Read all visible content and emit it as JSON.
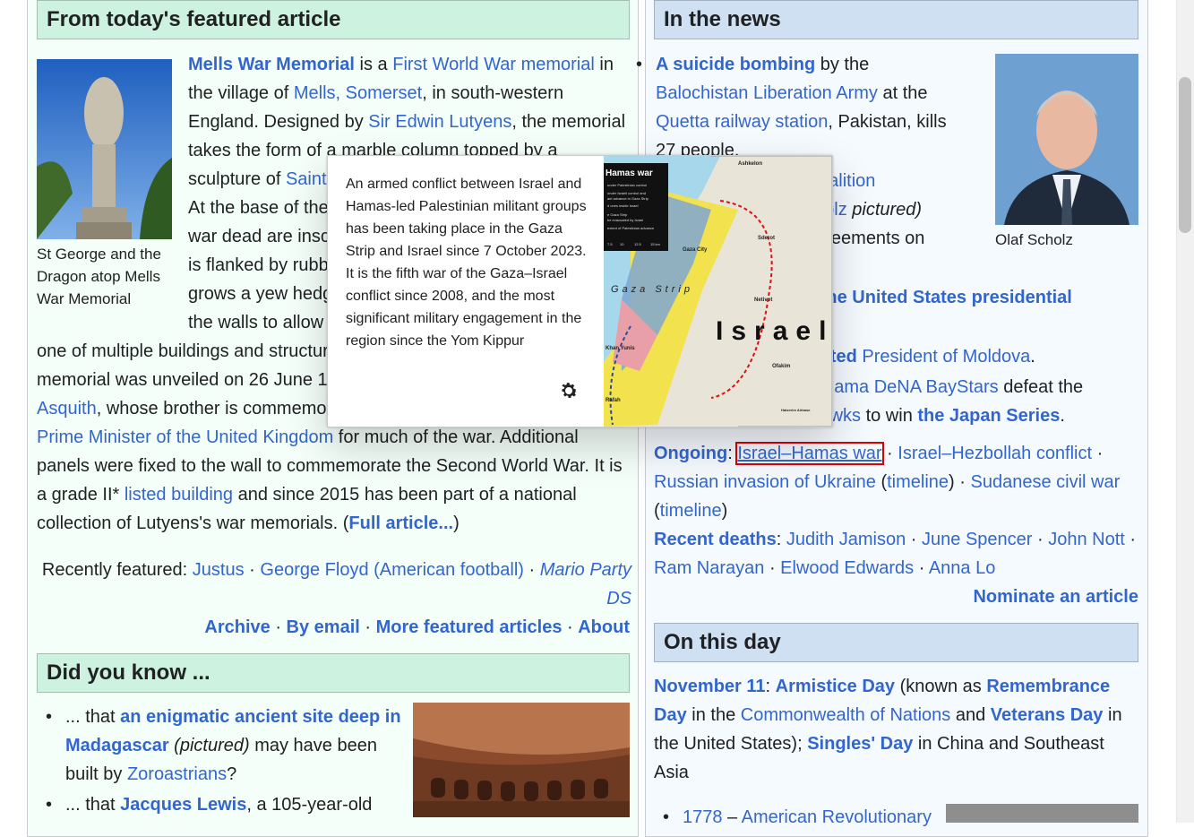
{
  "featured": {
    "heading": "From today's featured article",
    "image_caption": "St George and the Dragon atop Mells War Memorial",
    "lines": [
      [
        {
          "t": "Mells War Memorial",
          "k": "b"
        },
        {
          "t": " is a ",
          "k": "p"
        },
        {
          "t": "First World War memorial",
          "k": "a"
        },
        {
          "t": " in",
          "k": "p"
        }
      ],
      [
        {
          "t": "the village of ",
          "k": "p"
        },
        {
          "t": "Mells, Somerset",
          "k": "a"
        },
        {
          "t": ", in south-western",
          "k": "p"
        }
      ],
      [
        {
          "t": "England. Designed by ",
          "k": "p"
        },
        {
          "t": "Sir Edwin Lutyens",
          "k": "a"
        },
        {
          "t": ", the memorial",
          "k": "p"
        }
      ],
      [
        {
          "t": "takes the form of a marble column topped by a",
          "k": "p"
        }
      ],
      [
        {
          "t": "sculpture of ",
          "k": "p"
        },
        {
          "t": "Saint",
          "k": "a"
        }
      ],
      [
        {
          "t": "At the base of the",
          "k": "p"
        }
      ],
      [
        {
          "t": "war dead are insc",
          "k": "p"
        }
      ],
      [
        {
          "t": "is flanked by rubb",
          "k": "p"
        }
      ],
      [
        {
          "t": "grows a yew hedg",
          "k": "p"
        }
      ],
      [
        {
          "t": "the walls to allow",
          "k": "p"
        }
      ]
    ],
    "wide_lines": [
      [
        {
          "t": "one of multiple buildings and structur",
          "k": "p"
        }
      ],
      [
        {
          "t": "memorial was unveiled on 26 June 1",
          "k": "p"
        }
      ],
      [
        {
          "t": "Asquith",
          "k": "a"
        },
        {
          "t": ", whose brother is commemo",
          "k": "p"
        }
      ],
      [
        {
          "t": "Prime Minister of the United Kingdom",
          "k": "a"
        },
        {
          "t": " for much of the war. Additional",
          "k": "p"
        }
      ],
      [
        {
          "t": "panels were fixed to the wall to commemorate the Second World War. It is",
          "k": "p"
        }
      ],
      [
        {
          "t": "a grade II* ",
          "k": "p"
        },
        {
          "t": "listed building",
          "k": "a"
        },
        {
          "t": " and since 2015 has been part of a national",
          "k": "p"
        }
      ],
      [
        {
          "t": "collection of Lutyens's war memorials. (",
          "k": "p"
        },
        {
          "t": "Full article...",
          "k": "b"
        },
        {
          "t": ")",
          "k": "p"
        }
      ]
    ],
    "recently_label": "Recently featured: ",
    "recently_items": [
      "Justus",
      "George Floyd (American football)",
      "Mario Party DS"
    ],
    "footer_links": [
      "Archive",
      "By email",
      "More featured articles",
      "About"
    ]
  },
  "dyk": {
    "heading": "Did you know ...",
    "items": [
      [
        {
          "t": "... that ",
          "k": "p"
        },
        {
          "t": "an enigmatic ancient site deep in",
          "k": "b"
        }
      ],
      [
        {
          "t": "Madagascar",
          "k": "b"
        },
        {
          "t": " (pictured)",
          "k": "i"
        },
        {
          "t": " may have been",
          "k": "p"
        }
      ],
      [
        {
          "t": "built by ",
          "k": "p"
        },
        {
          "t": "Zoroastrians",
          "k": "a"
        },
        {
          "t": "?",
          "k": "p"
        }
      ],
      [
        {
          "t": "... that ",
          "k": "p"
        },
        {
          "t": "Jacques Lewis",
          "k": "b"
        },
        {
          "t": ", a 105-year-old",
          "k": "p"
        }
      ]
    ]
  },
  "news": {
    "heading": "In the news",
    "image_caption": "Olaf Scholz",
    "lines": [
      [
        {
          "t": "A suicide bombing",
          "k": "b"
        },
        {
          "t": " by the",
          "k": "p"
        }
      ],
      [
        {
          "t": "Balochistan Liberation Army",
          "k": "a"
        },
        {
          "t": " at the",
          "k": "p"
        }
      ],
      [
        {
          "t": "Quetta railway station",
          "k": "a"
        },
        {
          "t": ", Pakistan, kills",
          "k": "p"
        }
      ],
      [
        {
          "t": "27 people.",
          "k": "p"
        }
      ],
      [
        {
          "t": "coalition",
          "k": "a"
        }
      ],
      [
        {
          "t": "cholz",
          "k": "a"
        },
        {
          "t": " pictured)",
          "k": "i"
        }
      ],
      [
        {
          "t": "agreements on",
          "k": "p"
        }
      ],
      [
        {
          "t": "s ",
          "k": "b"
        },
        {
          "t": "the United States presidential",
          "k": "b"
        }
      ],
      [
        {
          "t": "lected",
          "k": "b"
        },
        {
          "t": " President of Moldova",
          "k": "a"
        },
        {
          "t": ".",
          "k": "p"
        }
      ],
      [
        {
          "t": "kohama DeNA BayStars",
          "k": "a"
        },
        {
          "t": " defeat the",
          "k": "p"
        }
      ],
      [
        {
          "t": "Hawks",
          "k": "a"
        },
        {
          "t": " to win ",
          "k": "p"
        },
        {
          "t": "the Japan Series",
          "k": "b"
        },
        {
          "t": ".",
          "k": "p"
        }
      ]
    ],
    "ongoing_label": "Ongoing",
    "ongoing": [
      [
        {
          "t": "Israel–Hamas war",
          "k": "hl"
        },
        {
          "t": " · ",
          "k": "p"
        },
        {
          "t": "Israel–Hezbollah conflict",
          "k": "a"
        },
        {
          "t": " ·",
          "k": "p"
        }
      ],
      [
        {
          "t": "Russian invasion of Ukraine",
          "k": "a"
        },
        {
          "t": " (",
          "k": "p"
        },
        {
          "t": "timeline",
          "k": "a"
        },
        {
          "t": ") · ",
          "k": "p"
        },
        {
          "t": "Sudanese civil war",
          "k": "a"
        }
      ],
      [
        {
          "t": "(",
          "k": "p"
        },
        {
          "t": "timeline",
          "k": "a"
        },
        {
          "t": ")",
          "k": "p"
        }
      ]
    ],
    "deaths_label": "Recent deaths",
    "deaths": [
      [
        {
          "t": "Judith Jamison",
          "k": "a"
        },
        {
          "t": " · ",
          "k": "p"
        },
        {
          "t": "June Spencer",
          "k": "a"
        },
        {
          "t": " · ",
          "k": "p"
        },
        {
          "t": "John Nott",
          "k": "a"
        },
        {
          "t": " ·",
          "k": "p"
        }
      ],
      [
        {
          "t": "Ram Narayan",
          "k": "a"
        },
        {
          "t": " · ",
          "k": "p"
        },
        {
          "t": "Elwood Edwards",
          "k": "a"
        },
        {
          "t": " · ",
          "k": "p"
        },
        {
          "t": "Anna Lo",
          "k": "a"
        }
      ]
    ],
    "nominate": "Nominate an article"
  },
  "otd": {
    "heading": "On this day",
    "lines": [
      [
        {
          "t": "November 11",
          "k": "b"
        },
        {
          "t": ": ",
          "k": "p"
        },
        {
          "t": "Armistice Day",
          "k": "b"
        },
        {
          "t": " (known as ",
          "k": "p"
        },
        {
          "t": "Remembrance",
          "k": "b"
        }
      ],
      [
        {
          "t": "Day",
          "k": "b"
        },
        {
          "t": " in the ",
          "k": "p"
        },
        {
          "t": "Commonwealth of Nations",
          "k": "a"
        },
        {
          "t": " and ",
          "k": "p"
        },
        {
          "t": "Veterans Day",
          "k": "b"
        },
        {
          "t": " in",
          "k": "p"
        }
      ],
      [
        {
          "t": "the United States); ",
          "k": "p"
        },
        {
          "t": "Singles' Day",
          "k": "b"
        },
        {
          "t": " in China and Southeast",
          "k": "p"
        }
      ],
      [
        {
          "t": "Asia",
          "k": "p"
        }
      ]
    ],
    "first_item": [
      {
        "t": "1778",
        "k": "a"
      },
      {
        "t": " – ",
        "k": "p"
      },
      {
        "t": "American Revolutionary",
        "k": "a"
      }
    ]
  },
  "popup": {
    "extract": "An armed conflict between Israel and Hamas-led Palestinian militant groups has been taking place in the Gaza Strip and Israel since 7 October 2023. It is the fifth war of the Gaza–Israel conflict since 2008, and the most significant military engagement in the region since the Yom Kippur",
    "map": {
      "legend_title": "Hamas war",
      "legend_lines": [
        "under Palestinian control",
        "under Israeli control and",
        "ael advance in Gaza Strip",
        "d ones inside Israel",
        "",
        "e Gaza Strip",
        "be evacuated by Israel",
        "extent of Palestinian advance"
      ],
      "scale_labels": [
        "7.5",
        "10",
        "12.5",
        "15 km"
      ],
      "region_label": "Israel",
      "strip_label": "Gaza Strip",
      "places": [
        "Ashkelon",
        "Gaza City",
        "Sderot",
        "Netivot",
        "Khan Yunis",
        "Ofakim",
        "Rafah",
        "Hatzerim Airbase"
      ]
    },
    "settings_icon": "gear-icon"
  },
  "colors": {
    "link": "#3366cc",
    "featured_header_bg": "#cef2e0",
    "news_header_bg": "#cee0f2",
    "highlight_outline": "#dd0000"
  }
}
